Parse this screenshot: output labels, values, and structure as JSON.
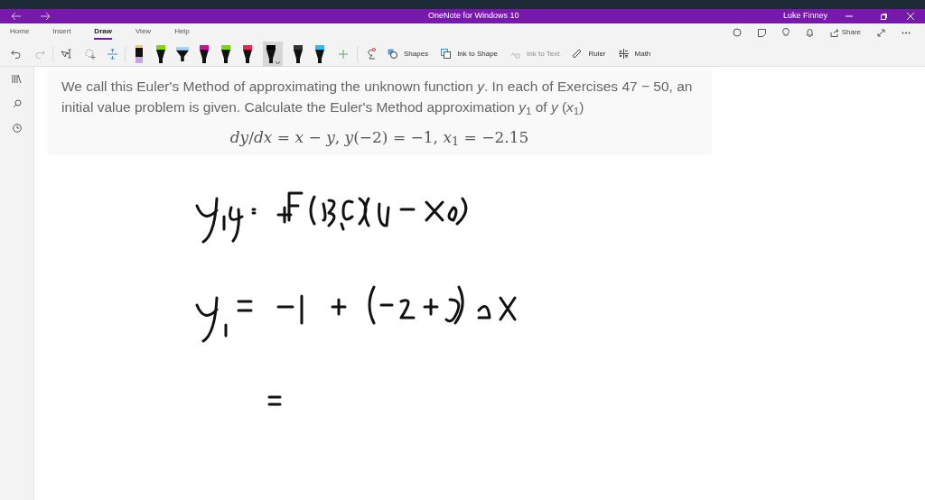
{
  "window": {
    "title": "OneNote for Windows 10",
    "user": "Luke Finney"
  },
  "tabs": [
    {
      "label": "Home",
      "selected": false
    },
    {
      "label": "Insert",
      "selected": false
    },
    {
      "label": "Draw",
      "selected": true
    },
    {
      "label": "View",
      "selected": false
    },
    {
      "label": "Help",
      "selected": false
    }
  ],
  "header_actions": {
    "share": "Share"
  },
  "pens": [
    {
      "kind": "marker",
      "color": "#c8a2e0",
      "selected": false
    },
    {
      "kind": "pen",
      "color": "#7ed321",
      "selected": false
    },
    {
      "kind": "highlighter",
      "color": "#9fd3f5",
      "selected": false
    },
    {
      "kind": "pen",
      "color": "#c2188f",
      "selected": false
    },
    {
      "kind": "pen",
      "color": "#7ed321",
      "selected": false
    },
    {
      "kind": "pen",
      "color": "#e8294f",
      "selected": false
    },
    {
      "kind": "pen",
      "color": "#000000",
      "selected": true
    },
    {
      "kind": "pen",
      "color": "#333333",
      "selected": false
    },
    {
      "kind": "pen",
      "color": "#3cb4f0",
      "selected": false
    }
  ],
  "tools": [
    {
      "kind": "shapes",
      "label": "Shapes",
      "disabled": false
    },
    {
      "kind": "ink-to-shape",
      "label": "Ink to Shape",
      "disabled": false
    },
    {
      "kind": "ink-to-text",
      "label": "Ink to Text",
      "disabled": true
    },
    {
      "kind": "ruler",
      "label": "Ruler",
      "disabled": false
    },
    {
      "kind": "math",
      "label": "Math",
      "disabled": false
    }
  ],
  "page": {
    "paragraph": "We call this Euler's Method of approximating the unknown function *y*. In each of Exercises 47 − 50, an initial value problem is given. Calculate the Euler's Method approximation *y*$_{1}$ of *y* (*x*$_{1}$)",
    "equation": "*dy*/*dx* = *x* − *y*, *y*(−2) = −1, *x*$_{1}$ = −2.15"
  }
}
